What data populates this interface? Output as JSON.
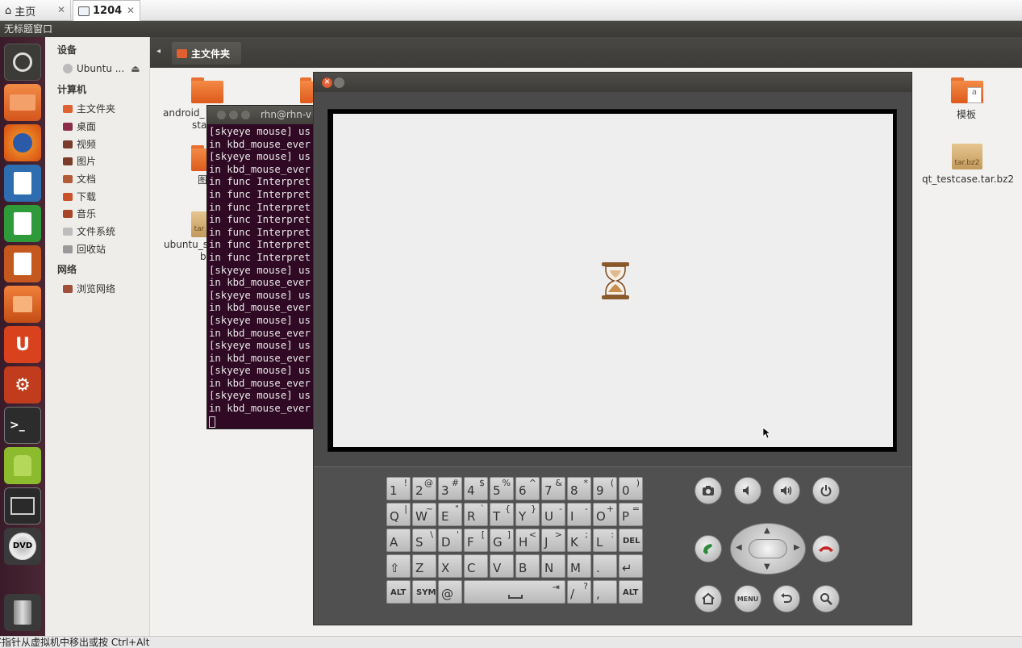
{
  "host_tabs": [
    {
      "label": "主页",
      "icon": "home-icon"
    },
    {
      "label": "1204",
      "icon": "vm-icon"
    }
  ],
  "panel": {
    "title": "无标题窗口"
  },
  "launcher": [
    "ubuntu-dash-icon",
    "files-icon",
    "firefox-icon",
    "writer-icon",
    "calc-icon",
    "impress-icon",
    "software-center-icon",
    "ubuntu-one-icon",
    "system-settings-icon",
    "terminal-icon",
    "android-icon",
    "workspace-switcher-icon",
    "dvd-icon",
    "trash-icon"
  ],
  "sidebar": {
    "devices_header": "设备",
    "device_item": "Ubuntu ...",
    "computer_header": "计算机",
    "computer_items": [
      "主文件夹",
      "桌面",
      "视频",
      "图片",
      "文档",
      "下载",
      "音乐",
      "文件系统",
      "回收站"
    ],
    "network_header": "网络",
    "network_items": [
      "浏览网络"
    ]
  },
  "breadcrumb": {
    "label": "主文件夹"
  },
  "files": [
    {
      "name": "android_",
      "line2": "sta"
    },
    {
      "name": "图",
      "line2": ""
    },
    {
      "name": "ubuntu_s",
      "line2": "b"
    },
    {
      "name": "模板",
      "line2": ""
    },
    {
      "name": "qt_testcase.tar.bz2",
      "line2": "",
      "icon_text": "tar.bz2"
    },
    {
      "icon_text": "tar"
    }
  ],
  "terminal": {
    "title": "rhn@rhn-v",
    "lines": [
      "[skyeye mouse] us",
      "in kbd_mouse_ever",
      "[skyeye mouse] us",
      "in kbd_mouse_ever",
      "in func Interpret",
      "in func Interpret",
      "in func Interpret",
      "in func Interpret",
      "in func Interpret",
      "in func Interpret",
      "in func Interpret",
      "[skyeye mouse] us",
      "in kbd_mouse_ever",
      "[skyeye mouse] us",
      "in kbd_mouse_ever",
      "[skyeye mouse] us",
      "in kbd_mouse_ever",
      "[skyeye mouse] us",
      "in kbd_mouse_ever",
      "[skyeye mouse] us",
      "in kbd_mouse_ever",
      "[skyeye mouse] us",
      "in kbd_mouse_ever"
    ]
  },
  "keyboard": {
    "rows": [
      [
        [
          "1",
          "!"
        ],
        [
          "2",
          "@"
        ],
        [
          "3",
          "#"
        ],
        [
          "4",
          "$"
        ],
        [
          "5",
          "%"
        ],
        [
          "6",
          "^"
        ],
        [
          "7",
          "&"
        ],
        [
          "8",
          "*"
        ],
        [
          "9",
          "("
        ],
        [
          "0",
          ")"
        ]
      ],
      [
        [
          "Q",
          "|"
        ],
        [
          "W",
          "~"
        ],
        [
          "E",
          "\""
        ],
        [
          "R",
          "`"
        ],
        [
          "T",
          "{"
        ],
        [
          "Y",
          "}"
        ],
        [
          "U",
          "-"
        ],
        [
          "I",
          "-"
        ],
        [
          "O",
          "+"
        ],
        [
          "P",
          "="
        ]
      ],
      [
        [
          "A",
          ""
        ],
        [
          "S",
          "\\"
        ],
        [
          "D",
          "'"
        ],
        [
          "F",
          "["
        ],
        [
          "G",
          "]"
        ],
        [
          "H",
          "<"
        ],
        [
          "J",
          ">"
        ],
        [
          "K",
          ";"
        ],
        [
          "L",
          ":"
        ],
        [
          "DEL",
          ""
        ]
      ],
      [
        [
          "⇧",
          ""
        ],
        [
          "Z",
          ""
        ],
        [
          "X",
          ""
        ],
        [
          "C",
          ""
        ],
        [
          "V",
          ""
        ],
        [
          "B",
          ""
        ],
        [
          "N",
          ""
        ],
        [
          "M",
          ""
        ],
        [
          ".",
          ""
        ],
        [
          "↵",
          ""
        ]
      ],
      [
        [
          "ALT",
          ""
        ],
        [
          "SYM",
          ""
        ],
        [
          "@",
          ""
        ],
        [
          "",
          ""
        ],
        [
          "/",
          "?"
        ],
        [
          ",",
          ""
        ],
        [
          "ALT",
          ""
        ]
      ]
    ]
  },
  "controls": {
    "menu_label": "MENU"
  },
  "status": {
    "text": "将指针从虚拟机中移出或按 Ctrl+Alt"
  }
}
